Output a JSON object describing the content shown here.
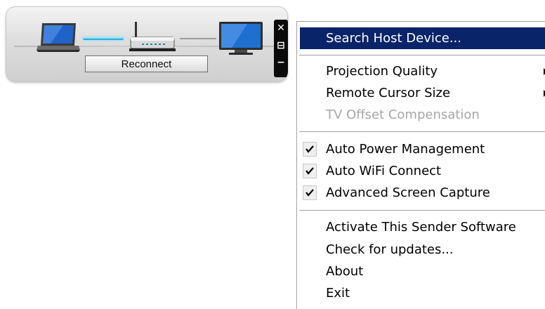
{
  "widget": {
    "reconnect_label": "Reconnect",
    "controls": [
      {
        "name": "close-icon",
        "glyph": "x"
      },
      {
        "name": "restore-icon",
        "glyph": "⊟"
      },
      {
        "name": "minimize-icon",
        "glyph": "—"
      }
    ],
    "devices": [
      "laptop-icon",
      "router-icon",
      "monitor-icon"
    ]
  },
  "menu": {
    "items": [
      {
        "label": "Search Host Device...",
        "highlighted": true
      },
      {
        "label": "Projection Quality",
        "submenu": true
      },
      {
        "label": "Remote Cursor Size",
        "submenu": true
      },
      {
        "label": "TV Offset Compensation",
        "disabled": true
      },
      {
        "label": "Auto Power Management",
        "checked": true
      },
      {
        "label": "Auto WiFi Connect",
        "checked": true
      },
      {
        "label": "Advanced Screen Capture",
        "checked": true
      },
      {
        "label": "Activate This Sender Software"
      },
      {
        "label": "Check for updates..."
      },
      {
        "label": "About"
      },
      {
        "label": "Exit"
      }
    ]
  },
  "colors": {
    "highlight": "#0a246a",
    "link_active": "#3fbde8",
    "disabled_text": "#a7a7a7"
  }
}
